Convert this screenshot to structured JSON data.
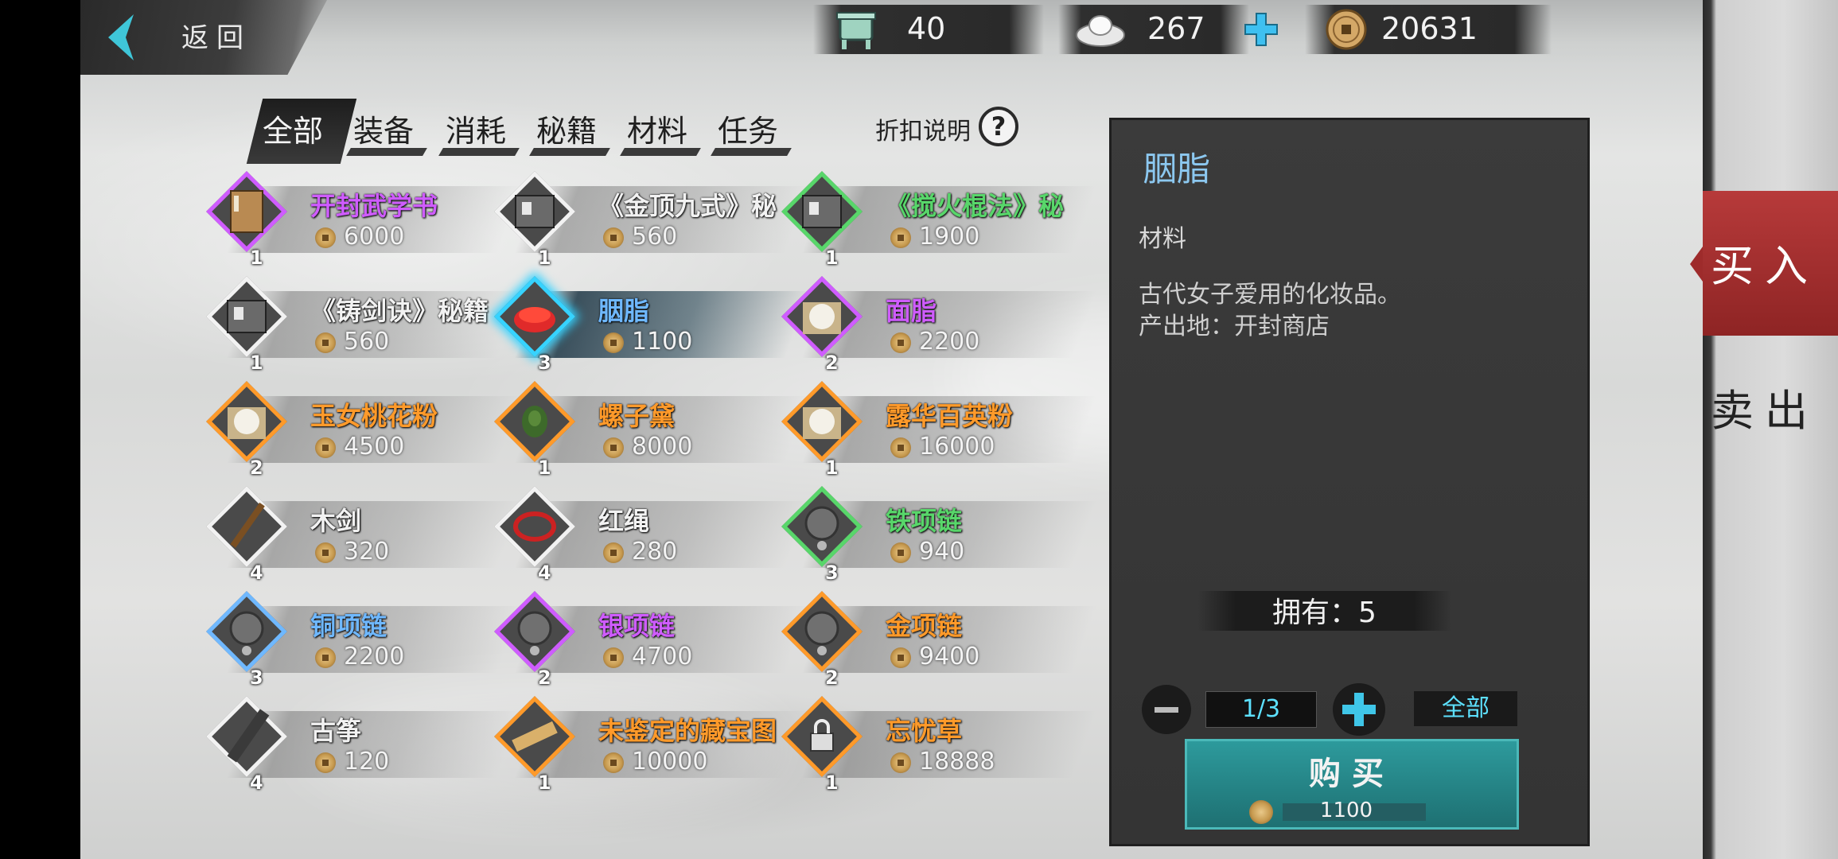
{
  "header": {
    "back_label": "返回",
    "resources": [
      {
        "name": "stamina",
        "icon": "cauldron-icon",
        "value": "40"
      },
      {
        "name": "silver",
        "icon": "silver-ingot-icon",
        "value": "267"
      },
      {
        "name": "copper",
        "icon": "copper-coin-icon",
        "value": "20631"
      }
    ]
  },
  "tabs": [
    {
      "label": "全部",
      "active": true
    },
    {
      "label": "装备",
      "active": false
    },
    {
      "label": "消耗",
      "active": false
    },
    {
      "label": "秘籍",
      "active": false
    },
    {
      "label": "材料",
      "active": false
    },
    {
      "label": "任务",
      "active": false
    }
  ],
  "discount_label": "折扣说明",
  "discount_help": "?",
  "colors": {
    "purple": "#cf5cff",
    "green": "#58d66a",
    "white": "#f2f2f2",
    "orange": "#ff9a2a",
    "blue": "#6fb8ff",
    "selected": "#36d3ff",
    "accent_cyan": "#5de1ff"
  },
  "items": [
    {
      "name": "开封武学书",
      "price": "6000",
      "qty": "1",
      "rarity": "purple",
      "icon": "book-icon",
      "selected": false
    },
    {
      "name": "《金顶九式》秘",
      "price": "560",
      "qty": "1",
      "rarity": "white",
      "icon": "scroll-icon",
      "selected": false
    },
    {
      "name": "《搅火棍法》秘",
      "price": "1900",
      "qty": "1",
      "rarity": "green",
      "icon": "scroll-icon",
      "selected": false
    },
    {
      "name": "《铸剑诀》秘籍",
      "price": "560",
      "qty": "1",
      "rarity": "white",
      "icon": "scroll-icon",
      "selected": false
    },
    {
      "name": "胭脂",
      "price": "1100",
      "qty": "3",
      "rarity": "blue",
      "icon": "rouge-icon",
      "selected": true
    },
    {
      "name": "面脂",
      "price": "2200",
      "qty": "2",
      "rarity": "purple",
      "icon": "cream-icon",
      "selected": false
    },
    {
      "name": "玉女桃花粉",
      "price": "4500",
      "qty": "2",
      "rarity": "orange",
      "icon": "powder-icon",
      "selected": false
    },
    {
      "name": "螺子黛",
      "price": "8000",
      "qty": "1",
      "rarity": "orange",
      "icon": "eyebrow-ink-icon",
      "selected": false
    },
    {
      "name": "露华百英粉",
      "price": "16000",
      "qty": "1",
      "rarity": "orange",
      "icon": "powder-icon",
      "selected": false
    },
    {
      "name": "木剑",
      "price": "320",
      "qty": "4",
      "rarity": "white",
      "icon": "wooden-sword-icon",
      "selected": false
    },
    {
      "name": "红绳",
      "price": "280",
      "qty": "4",
      "rarity": "white",
      "icon": "red-rope-icon",
      "selected": false
    },
    {
      "name": "铁项链",
      "price": "940",
      "qty": "3",
      "rarity": "green",
      "icon": "necklace-icon",
      "selected": false
    },
    {
      "name": "铜项链",
      "price": "2200",
      "qty": "3",
      "rarity": "blue",
      "icon": "necklace-icon",
      "selected": false
    },
    {
      "name": "银项链",
      "price": "4700",
      "qty": "2",
      "rarity": "purple",
      "icon": "necklace-icon",
      "selected": false
    },
    {
      "name": "金项链",
      "price": "9400",
      "qty": "2",
      "rarity": "orange",
      "icon": "necklace-icon",
      "selected": false
    },
    {
      "name": "古筝",
      "price": "120",
      "qty": "4",
      "rarity": "white",
      "icon": "zither-icon",
      "selected": false
    },
    {
      "name": "未鉴定的藏宝图",
      "price": "10000",
      "qty": "1",
      "rarity": "orange",
      "icon": "treasure-map-icon",
      "selected": false
    },
    {
      "name": "忘忧草",
      "price": "18888",
      "qty": "1",
      "rarity": "orange",
      "icon": "locked-herb-icon",
      "selected": false
    }
  ],
  "detail": {
    "title": "胭脂",
    "category": "材料",
    "description_line1": "古代女子爱用的化妆品。",
    "description_line2": "产出地：开封商店",
    "owned": "拥有：5",
    "quantity": "1/3",
    "all_label": "全部",
    "buy_label": "购买",
    "buy_price": "1100"
  },
  "side_tabs": {
    "buy_label": "买入",
    "sell_label": "卖出"
  }
}
